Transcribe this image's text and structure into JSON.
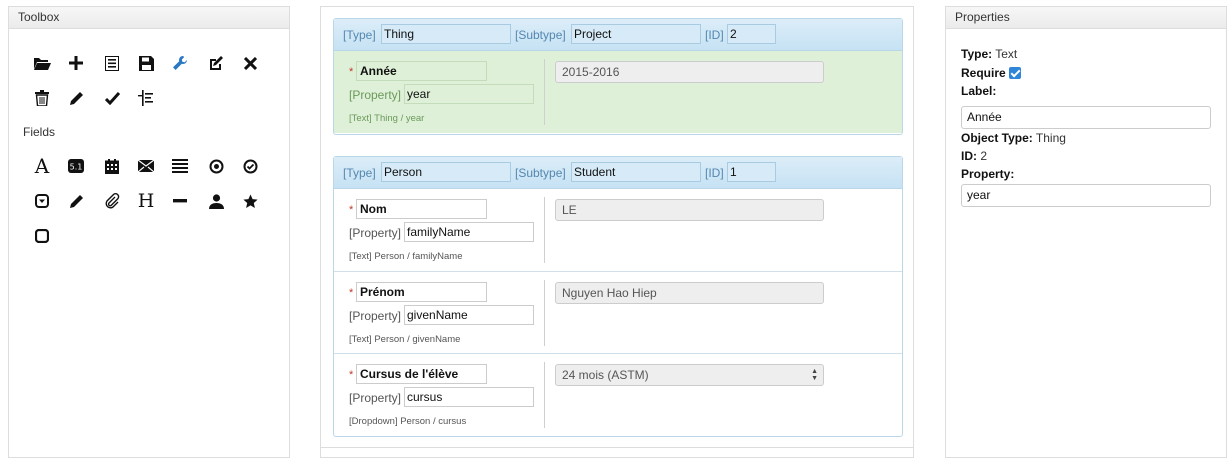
{
  "toolbox": {
    "title": "Toolbox",
    "tools": [
      {
        "icon": "folder-open-icon"
      },
      {
        "icon": "plus-icon"
      },
      {
        "icon": "list-icon"
      },
      {
        "icon": "save-icon"
      },
      {
        "icon": "wrench-icon"
      },
      {
        "icon": "edit-icon"
      },
      {
        "icon": "close-icon"
      },
      {
        "icon": "trash-icon"
      },
      {
        "icon": "pencil-icon"
      },
      {
        "icon": "check-icon"
      },
      {
        "icon": "indent-icon"
      }
    ],
    "fields_label": "Fields",
    "fields": [
      {
        "icon": "text-field-icon",
        "glyph": "A"
      },
      {
        "icon": "number-field-icon",
        "glyph": "5.1"
      },
      {
        "icon": "date-field-icon"
      },
      {
        "icon": "email-field-icon"
      },
      {
        "icon": "textarea-field-icon"
      },
      {
        "icon": "radio-field-icon"
      },
      {
        "icon": "checkbox-field-icon"
      },
      {
        "icon": "dropdown-field-icon"
      },
      {
        "icon": "pencil-field-icon"
      },
      {
        "icon": "attachment-field-icon"
      },
      {
        "icon": "heading-field-icon",
        "glyph": "H"
      },
      {
        "icon": "separator-field-icon"
      },
      {
        "icon": "person-field-icon"
      },
      {
        "icon": "star-field-icon"
      },
      {
        "icon": "square-field-icon"
      }
    ]
  },
  "canvas": {
    "blocks": [
      {
        "type_label": "[Type]",
        "type_value": "Thing",
        "subtype_label": "[Subtype]",
        "subtype_value": "Project",
        "id_label": "[ID]",
        "id_value": "2",
        "rows": [
          {
            "required": "*",
            "label": "Année",
            "property_label": "[Property]",
            "property": "year",
            "meta": "[Text] Thing / year",
            "value": "2015-2016",
            "kind": "text",
            "selected": true
          }
        ]
      },
      {
        "type_label": "[Type]",
        "type_value": "Person",
        "subtype_label": "[Subtype]",
        "subtype_value": "Student",
        "id_label": "[ID]",
        "id_value": "1",
        "rows": [
          {
            "required": "*",
            "label": "Nom",
            "property_label": "[Property]",
            "property": "familyName",
            "meta": "[Text] Person / familyName",
            "value": "LE",
            "kind": "text",
            "selected": false
          },
          {
            "required": "*",
            "label": "Prénom",
            "property_label": "[Property]",
            "property": "givenName",
            "meta": "[Text] Person / givenName",
            "value": "Nguyen Hao Hiep",
            "kind": "text",
            "selected": false
          },
          {
            "required": "*",
            "label": "Cursus de l'élève",
            "property_label": "[Property]",
            "property": "cursus",
            "meta": "[Dropdown] Person / cursus",
            "value": "24 mois (ASTM)",
            "kind": "dropdown",
            "selected": false
          }
        ]
      }
    ]
  },
  "properties": {
    "title": "Properties",
    "type_label": "Type:",
    "type_value": "Text",
    "require_label": "Require",
    "require_checked": true,
    "label_label": "Label:",
    "label_value": "Année",
    "object_type_label": "Object Type:",
    "object_type_value": "Thing",
    "id_label": "ID:",
    "id_value": "2",
    "property_label": "Property:",
    "property_value": "year"
  },
  "colors": {
    "header_blue": "#c6e2f4",
    "selected_green": "#dff0d8",
    "checkbox_blue": "#2f86d6"
  }
}
